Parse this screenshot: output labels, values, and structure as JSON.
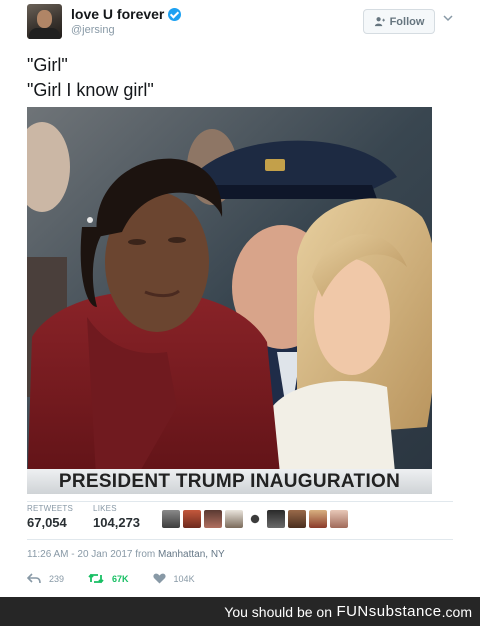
{
  "tweet": {
    "display_name": "love U forever",
    "handle": "@jersing",
    "follow_label": "Follow",
    "text_lines": [
      "\"Girl\"",
      "\"Girl I know girl\""
    ],
    "photo": {
      "caption": "PRESIDENT TRUMP INAUGURATION"
    },
    "stats": {
      "retweets_label": "RETWEETS",
      "retweets_value": "67,054",
      "likes_label": "LIKES",
      "likes_value": "104,273"
    },
    "timestamp": {
      "time_date": "11:26 AM - 20 Jan 2017 from ",
      "location": "Manhattan, NY"
    },
    "actions": {
      "reply_count": "239",
      "retweet_count": "67K",
      "like_count": "104K"
    }
  },
  "footer": {
    "text": "You should be on",
    "brand": "FUNsubstance",
    "domain": ".com"
  },
  "colors": {
    "verified": "#1da1f2",
    "retweet_active": "#17bf63",
    "footer_background": "#262626"
  },
  "icons": [
    "verified-icon",
    "add-user-icon",
    "chevron-down-icon",
    "reply-icon",
    "retweet-icon",
    "heart-icon"
  ]
}
